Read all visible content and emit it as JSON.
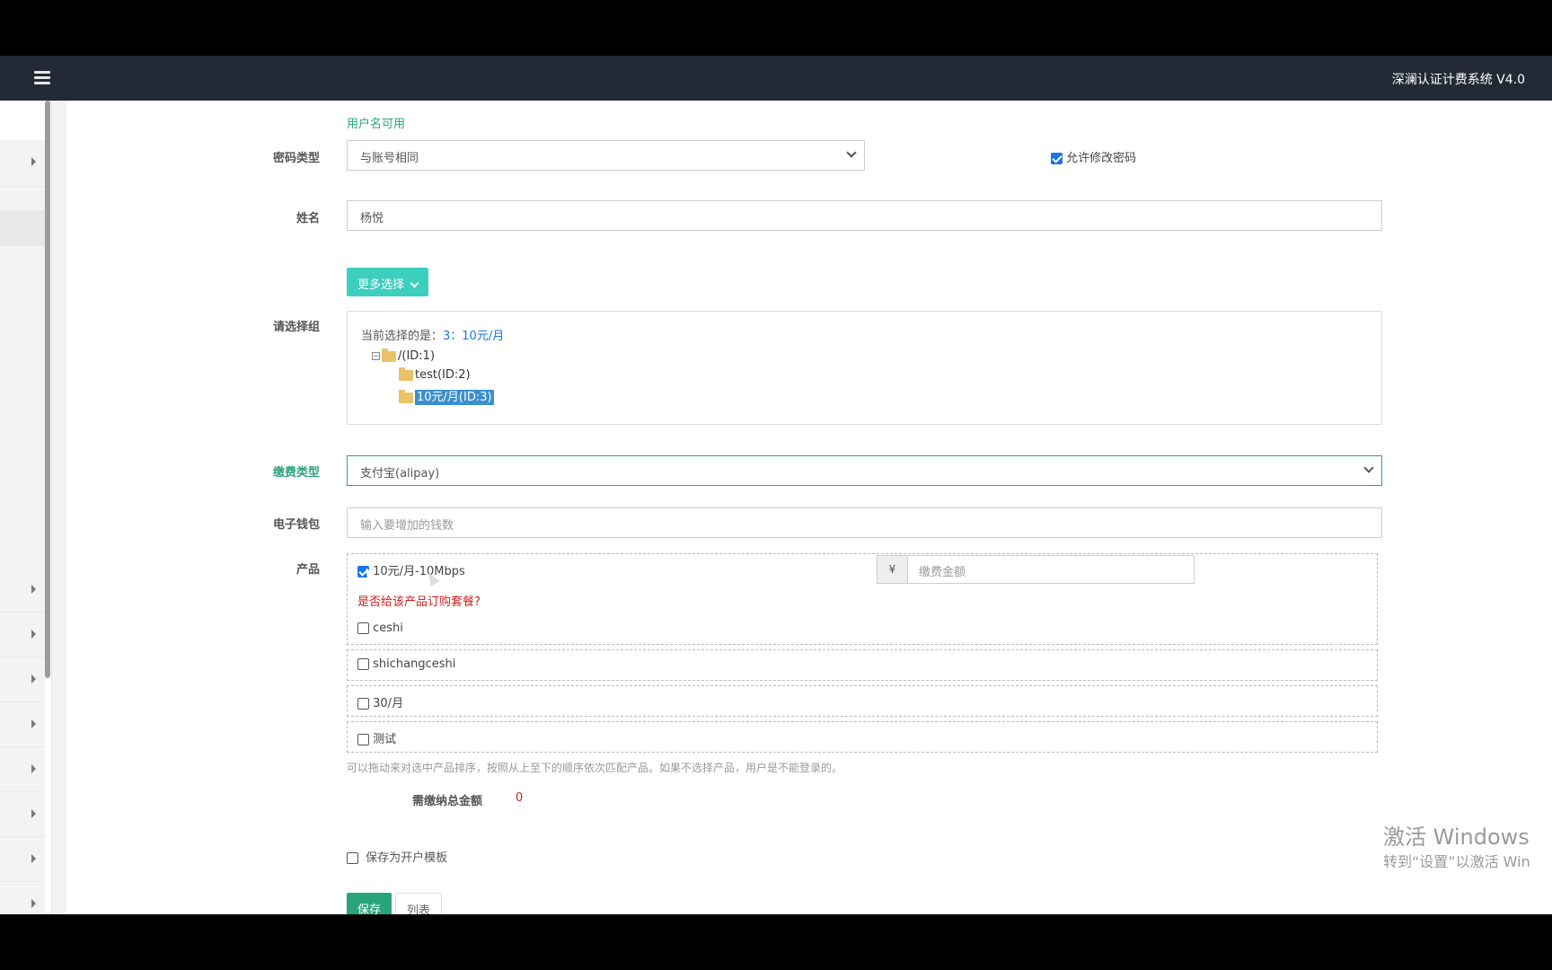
{
  "header": {
    "app_title": "深澜认证计费系统 V4.0"
  },
  "form": {
    "username_hint": "用户名可用",
    "password_type": {
      "label": "密码类型",
      "value": "与账号相同",
      "allow_change_label": "允许修改密码",
      "allow_change_checked": true
    },
    "name": {
      "label": "姓名",
      "value": "杨悦"
    },
    "more_button": "更多选择",
    "group": {
      "label": "请选择组",
      "current_prefix": "当前选择的是：",
      "current_value": "3：10元/月",
      "tree": [
        {
          "label": "/(ID:1)",
          "selected": false
        },
        {
          "label": "test(ID:2)",
          "selected": false
        },
        {
          "label": "10元/月(ID:3)",
          "selected": true
        }
      ]
    },
    "payment_type": {
      "label": "缴费类型",
      "value": "支付宝(alipay)"
    },
    "wallet": {
      "label": "电子钱包",
      "placeholder": "输入要增加的钱数"
    },
    "products": {
      "label": "产品",
      "items": [
        {
          "label": "10元/月-10Mbps",
          "checked": true
        },
        {
          "label": "ceshi",
          "checked": false
        },
        {
          "label": "shichangceshi",
          "checked": false
        },
        {
          "label": "30/月",
          "checked": false
        },
        {
          "label": "测试",
          "checked": false
        }
      ],
      "order_question": "是否给该产品订购套餐?",
      "currency_symbol": "¥",
      "amount_placeholder": "缴费金额",
      "help_text": "可以拖动来对选中产品排序，按照从上至下的顺序依次匹配产品。如果不选择产品，用户是不能登录的。"
    },
    "total": {
      "label": "需缴纳总金额",
      "value": "0"
    },
    "save_template": {
      "label": "保存为开户模板",
      "checked": false
    },
    "save_button": "保存",
    "list_button": "列表"
  },
  "watermark": {
    "line1": "激活 Windows",
    "line2": "转到“设置”以激活 Win"
  }
}
